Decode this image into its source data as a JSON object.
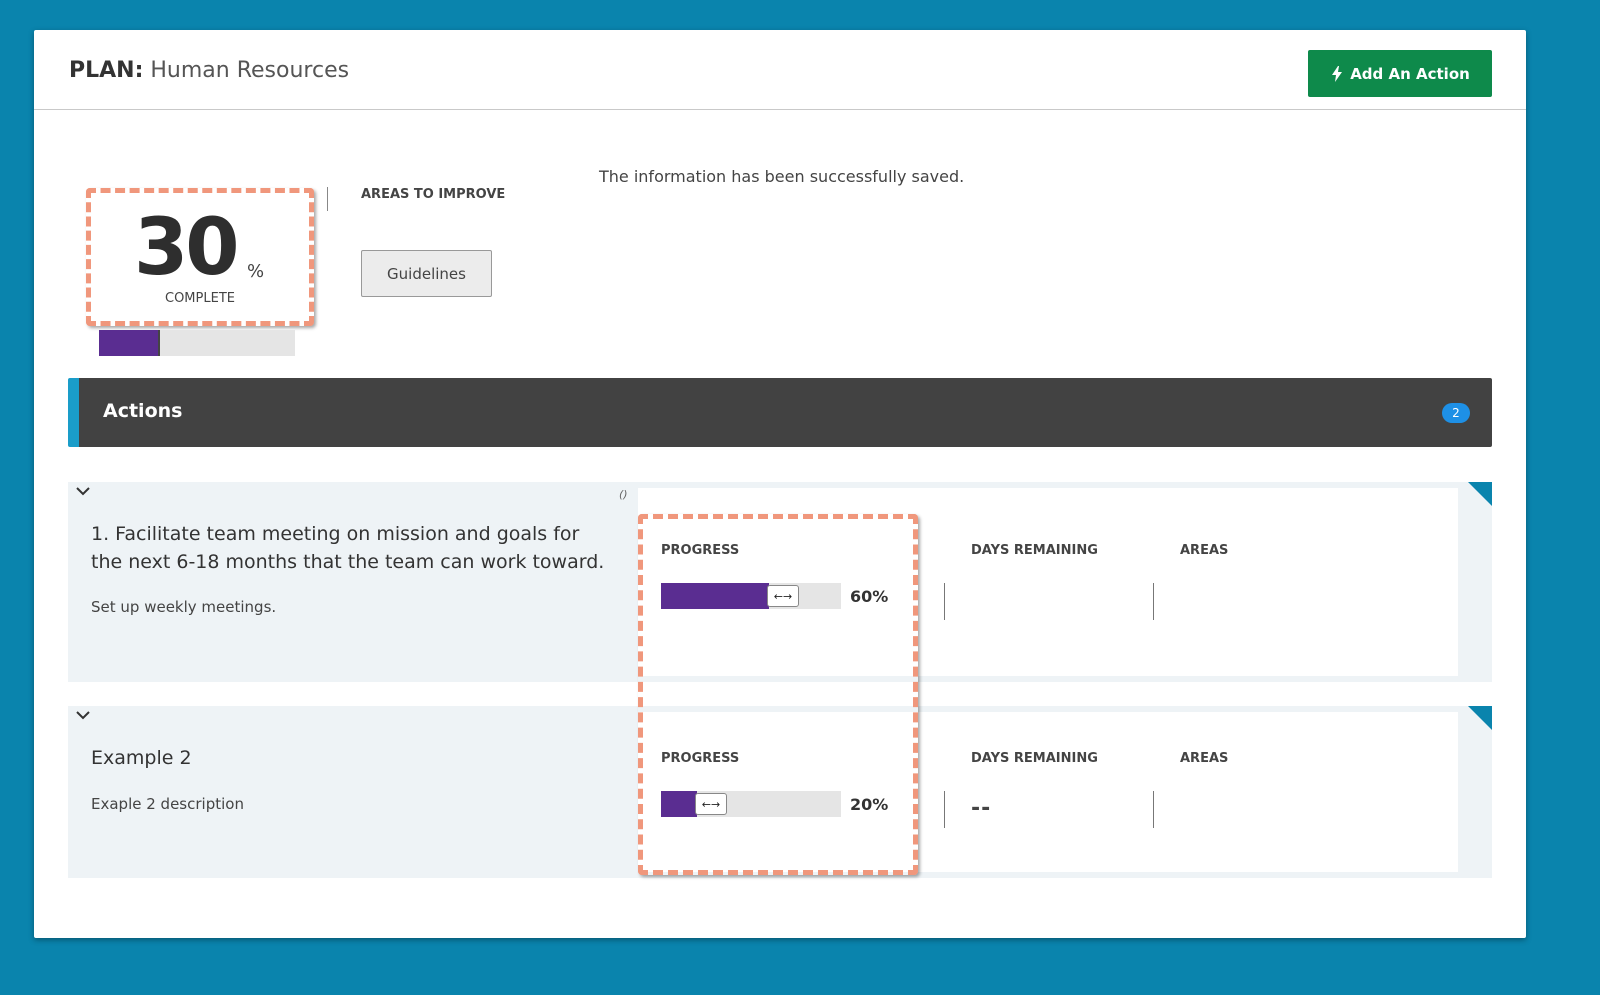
{
  "header": {
    "title_prefix": "PLAN:",
    "title_name": "Human Resources",
    "add_action_label": "Add An Action"
  },
  "summary": {
    "percent": "30",
    "percent_sign": "%",
    "complete_label": "COMPLETE",
    "overall_progress": 0.3,
    "areas_title": "AREAS TO IMPROVE",
    "guidelines_label": "Guidelines",
    "saved_message": "The information has been successfully saved."
  },
  "actions": {
    "title": "Actions",
    "count": "2",
    "items": [
      {
        "title": "1. Facilitate team meeting on mission and goals for the next 6-18 months that the team can work toward.",
        "description": "Set up weekly meetings.",
        "edit_mark": "()",
        "progress_label": "PROGRESS",
        "progress_value": "60%",
        "progress": 0.6,
        "days_label": "DAYS REMAINING",
        "days_value": "",
        "areas_label": "AREAS"
      },
      {
        "title": "Example 2",
        "description": "Exaple 2 description",
        "progress_label": "PROGRESS",
        "progress_value": "20%",
        "progress": 0.2,
        "days_label": "DAYS REMAINING",
        "days_value": "--",
        "areas_label": "AREAS"
      }
    ]
  },
  "colors": {
    "page_bg": "#0a84ad",
    "progress_fill": "#5a2d91",
    "add_button": "#0e8a4b",
    "actions_bar": "#424242",
    "actions_accent": "#1a9dc9",
    "count_badge": "#1e90e6",
    "highlight": "#f0977c"
  },
  "icons": {
    "add_action": "lightning-bolt-icon",
    "expand": "chevron-down-icon",
    "slider_handle": "left-right-arrows-icon"
  }
}
